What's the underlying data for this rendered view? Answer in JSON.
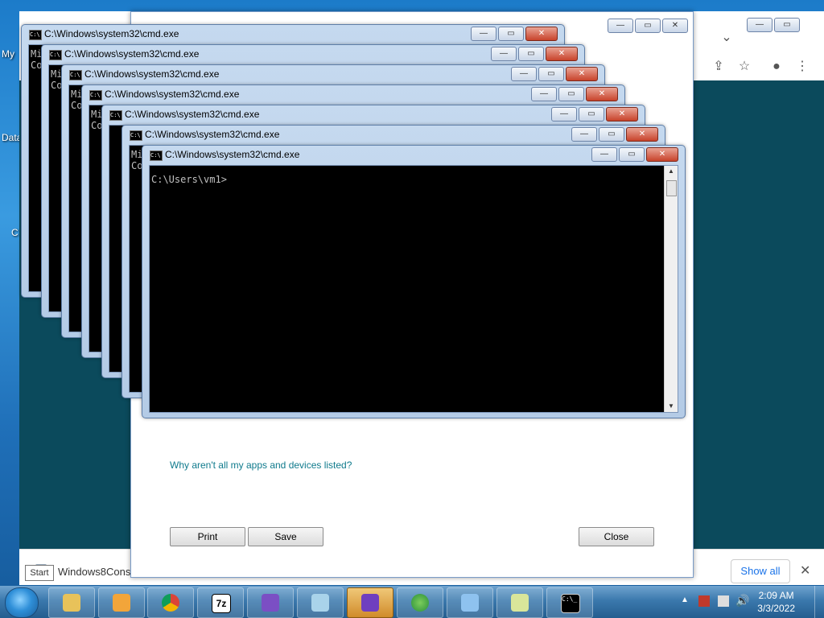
{
  "desktop": {
    "icon_labels": [
      "My",
      "Data",
      "C"
    ]
  },
  "browser": {
    "download_item": "Windows8Cons",
    "show_all": "Show all",
    "close_glyph": "✕"
  },
  "dialog": {
    "link": "Why aren't all my apps and devices listed?",
    "print_button": "Print",
    "save_button": "Save",
    "close_button": "Close"
  },
  "cmd": {
    "title": "C:\\Windows\\system32\\cmd.exe",
    "prompt": "C:\\Users\\vm1>",
    "partial_lines": [
      "Mi",
      "Co",
      "C:"
    ]
  },
  "start_tooltip": "Start",
  "taskbar": {
    "clock_time": "2:09 AM",
    "clock_date": "3/3/2022"
  },
  "colors": {
    "cmd_background": "#000000",
    "title_glass": "#c5d9ef",
    "link": "#0f7a8c",
    "desktop_teal": "#0b4a5c"
  }
}
